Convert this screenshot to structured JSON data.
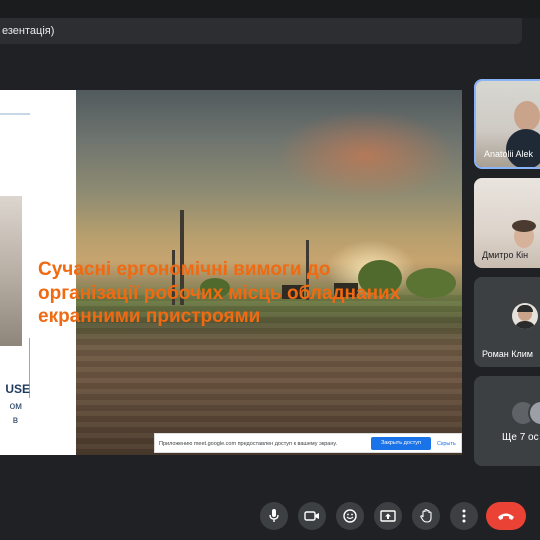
{
  "window": {
    "title": "езентація)"
  },
  "slide": {
    "title": "Сучасні ергономічні вимоги до організації робочих місць обладнаних екранними пристроями",
    "presenter_name_fragment": "USE",
    "presenter_line2_fragment": "ом",
    "presenter_line3_fragment": "в",
    "title_color": "#f06a12"
  },
  "share_notice": {
    "message": "Приложению meet.google.com предоставлен доступ к вашему экрану.",
    "stop_button": "Закрыть доступ",
    "hide_link": "Скрыть"
  },
  "participants": [
    {
      "name": "Anatolii Alek",
      "active": true
    },
    {
      "name": "Дмитро Кін"
    },
    {
      "name": "Роман Клим"
    },
    {
      "name": "Ще 7 ос"
    }
  ],
  "controls": {
    "icons": [
      "microphone-icon",
      "camera-icon",
      "emoji-icon",
      "present-screen-icon",
      "raise-hand-icon",
      "more-options-icon",
      "end-call-icon"
    ],
    "end_call_color": "#ea4335",
    "active_border_color": "#8ab4f8"
  }
}
